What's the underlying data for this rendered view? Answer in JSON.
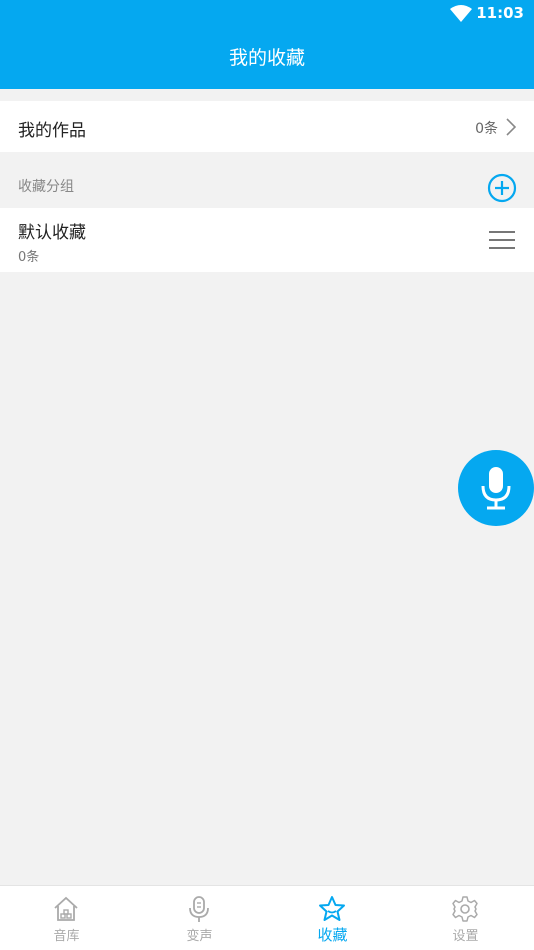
{
  "status_bar": {
    "time": "11:03",
    "wifi_icon": "wifi-icon"
  },
  "header": {
    "title": "我的收藏"
  },
  "my_works": {
    "label": "我的作品",
    "count": "0条"
  },
  "groups_section": {
    "label": "收藏分组",
    "add_icon": "add-circle-icon",
    "items": [
      {
        "name": "默认收藏",
        "count": "0条"
      }
    ]
  },
  "fab": {
    "icon": "microphone-icon"
  },
  "tabs": [
    {
      "label": "音库",
      "icon": "home-icon",
      "active": false
    },
    {
      "label": "变声",
      "icon": "microphone-icon",
      "active": false
    },
    {
      "label": "收藏",
      "icon": "star-icon",
      "active": true
    },
    {
      "label": "设置",
      "icon": "gear-icon",
      "active": false
    }
  ],
  "colors": {
    "accent": "#05a8f0",
    "background": "#f2f2f2",
    "inactive": "#aaaaaa"
  }
}
